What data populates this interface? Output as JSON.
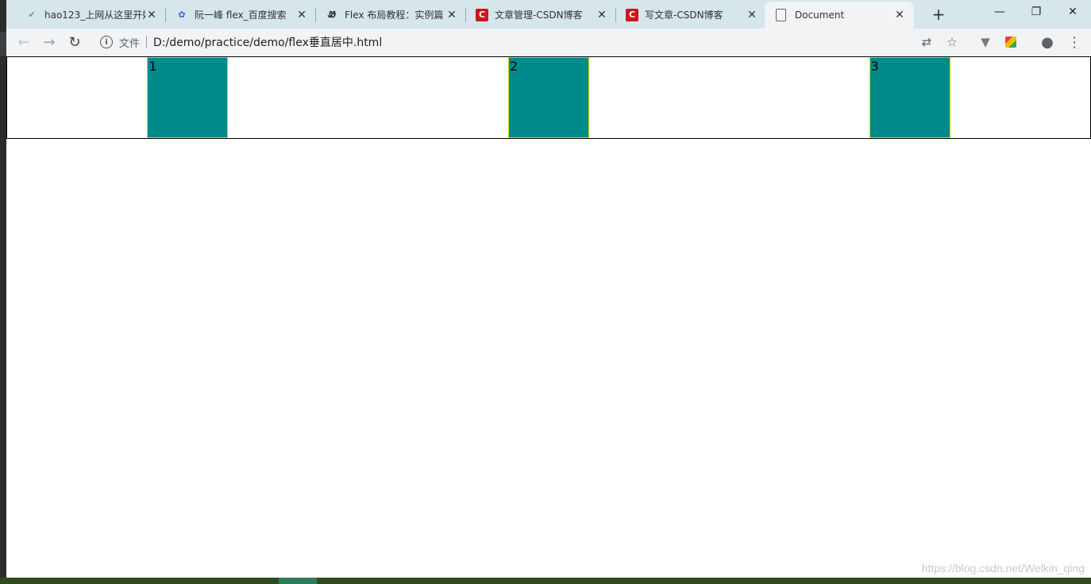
{
  "browser": {
    "tabs": [
      {
        "title": "hao123_上网从这里开始",
        "icon": "hao123-icon"
      },
      {
        "title": "阮一峰 flex_百度搜索",
        "icon": "baidu-paw-icon"
      },
      {
        "title": "Flex 布局教程：实例篇",
        "icon": "ruanyifeng-icon"
      },
      {
        "title": "文章管理-CSDN博客",
        "icon": "csdn-icon"
      },
      {
        "title": "写文章-CSDN博客",
        "icon": "csdn-icon"
      },
      {
        "title": "Document",
        "icon": "document-icon",
        "active": true
      }
    ],
    "address": {
      "scheme_label": "文件",
      "url": "D:/demo/practice/demo/flex垂直居中.html"
    }
  },
  "page": {
    "items": [
      "1",
      "2",
      "3"
    ],
    "item_color": "#008b8b",
    "item_border_color": "#c7e000"
  },
  "watermark": "https://blog.csdn.net/Welkin_qing"
}
